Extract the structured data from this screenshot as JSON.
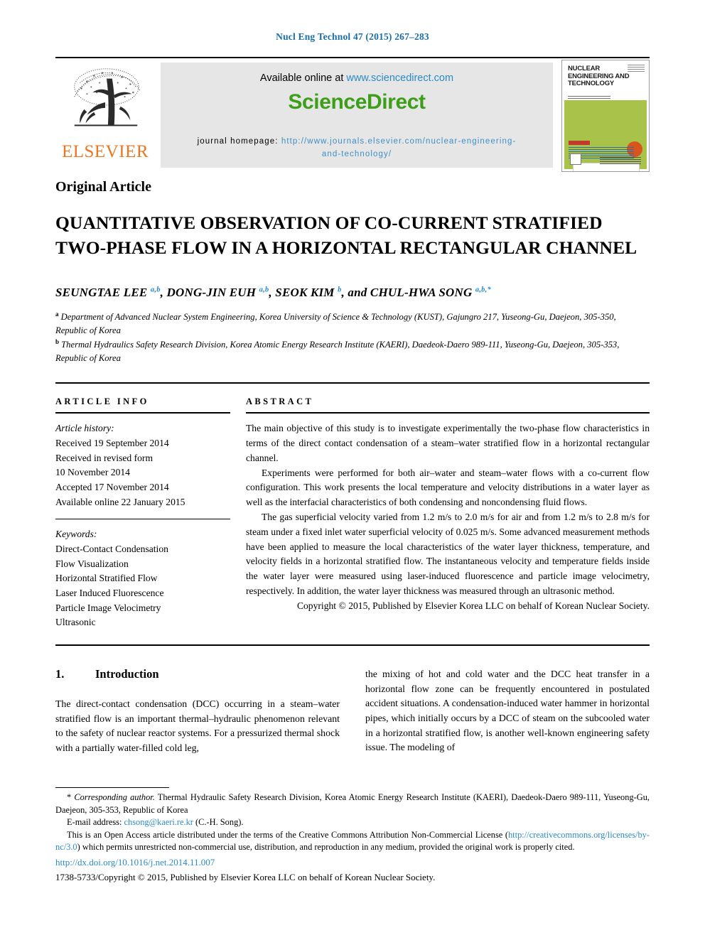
{
  "running_head": "Nucl Eng Technol 47 (2015) 267–283",
  "header": {
    "available_prefix": "Available online at ",
    "available_url": "www.sciencedirect.com",
    "sciencedirect_logo": "ScienceDirect",
    "homepage_label": "journal homepage: ",
    "homepage_url": "http://www.journals.elsevier.com/nuclear-engineering-and-technology/",
    "publisher_name": "ELSEVIER",
    "cover_title": "NUCLEAR ENGINEERING AND TECHNOLOGY"
  },
  "article": {
    "kicker": "Original Article",
    "title": "QUANTITATIVE OBSERVATION OF CO-CURRENT STRATIFIED TWO-PHASE FLOW IN A HORIZONTAL RECTANGULAR CHANNEL",
    "authors_html": "SEUNGTAE LEE <sup>a,b</sup>, DONG-JIN EUH <sup>a,b</sup>, SEOK KIM <sup>b</sup>, and CHUL-HWA SONG <sup>a,b,*</sup>",
    "affiliation_a": "Department of Advanced Nuclear System Engineering, Korea University of Science & Technology (KUST), Gajungro 217, Yuseong-Gu, Daejeon, 305-350, Republic of Korea",
    "affiliation_b": "Thermal Hydraulics Safety Research Division, Korea Atomic Energy Research Institute (KAERI), Daedeok-Daero 989-111, Yuseong-Gu, Daejeon, 305-353, Republic of Korea"
  },
  "info": {
    "heading": "ARTICLE INFO",
    "history_label": "Article history:",
    "history": [
      "Received 19 September 2014",
      "Received in revised form",
      "10 November 2014",
      "Accepted 17 November 2014",
      "Available online 22 January 2015"
    ],
    "keywords_label": "Keywords:",
    "keywords": [
      "Direct-Contact Condensation",
      "Flow Visualization",
      "Horizontal Stratified Flow",
      "Laser Induced Fluorescence",
      "Particle Image Velocimetry",
      "Ultrasonic"
    ]
  },
  "abstract": {
    "heading": "ABSTRACT",
    "paragraphs": [
      "The main objective of this study is to investigate experimentally the two-phase flow characteristics in terms of the direct contact condensation of a steam–water stratified flow in a horizontal rectangular channel.",
      "Experiments were performed for both air–water and steam–water flows with a co-current flow configuration. This work presents the local temperature and velocity distributions in a water layer as well as the interfacial characteristics of both condensing and noncondensing fluid flows.",
      "The gas superficial velocity varied from 1.2 m/s to 2.0 m/s for air and from 1.2 m/s to 2.8 m/s for steam under a fixed inlet water superficial velocity of 0.025 m/s. Some advanced measurement methods have been applied to measure the local characteristics of the water layer thickness, temperature, and velocity fields in a horizontal stratified flow. The instantaneous velocity and temperature fields inside the water layer were measured using laser-induced fluorescence and particle image velocimetry, respectively. In addition, the water layer thickness was measured through an ultrasonic method."
    ],
    "copyright": "Copyright © 2015, Published by Elsevier Korea LLC on behalf of Korean Nuclear Society."
  },
  "section": {
    "number": "1.",
    "heading": "Introduction",
    "col_left": "The direct-contact condensation (DCC) occurring in a steam–water stratified flow is an important thermal–hydraulic phenomenon relevant to the safety of nuclear reactor systems. For a pressurized thermal shock with a partially water-filled cold leg,",
    "col_right": "the mixing of hot and cold water and the DCC heat transfer in a horizontal flow zone can be frequently encountered in postulated accident situations. A condensation-induced water hammer in horizontal pipes, which initially occurs by a DCC of steam on the subcooled water in a horizontal stratified flow, is another well-known engineering safety issue. The modeling of"
  },
  "footnotes": {
    "corresponding_marker": "*",
    "corresponding_italic": "Corresponding author.",
    "corresponding_text": " Thermal Hydraulic Safety Research Division, Korea Atomic Energy Research Institute (KAERI), Daedeok-Daero 989-111, Yuseong-Gu, Daejeon, 305-353, Republic of Korea",
    "email_label": "E-mail address: ",
    "email_value": "chsong@kaeri.re.kr",
    "email_suffix": " (C.-H. Song).",
    "license_pre": "This is an Open Access article distributed under the terms of the Creative Commons Attribution Non-Commercial License (",
    "license_url": "http://creativecommons.org/licenses/by-nc/3.0",
    "license_post": ") which permits unrestricted non-commercial use, distribution, and reproduction in any medium, provided the original work is properly cited.",
    "doi": "http://dx.doi.org/10.1016/j.net.2014.11.007",
    "issn_copyright": "1738-5733/Copyright © 2015, Published by Elsevier Korea LLC on behalf of Korean Nuclear Society."
  },
  "colors": {
    "link_blue": "#2b8bc4",
    "running_head_blue": "#1a6ea8",
    "sciencedirect_green": "#3d9e19",
    "elsevier_orange": "#e87722",
    "cover_green": "#a8c24a"
  }
}
